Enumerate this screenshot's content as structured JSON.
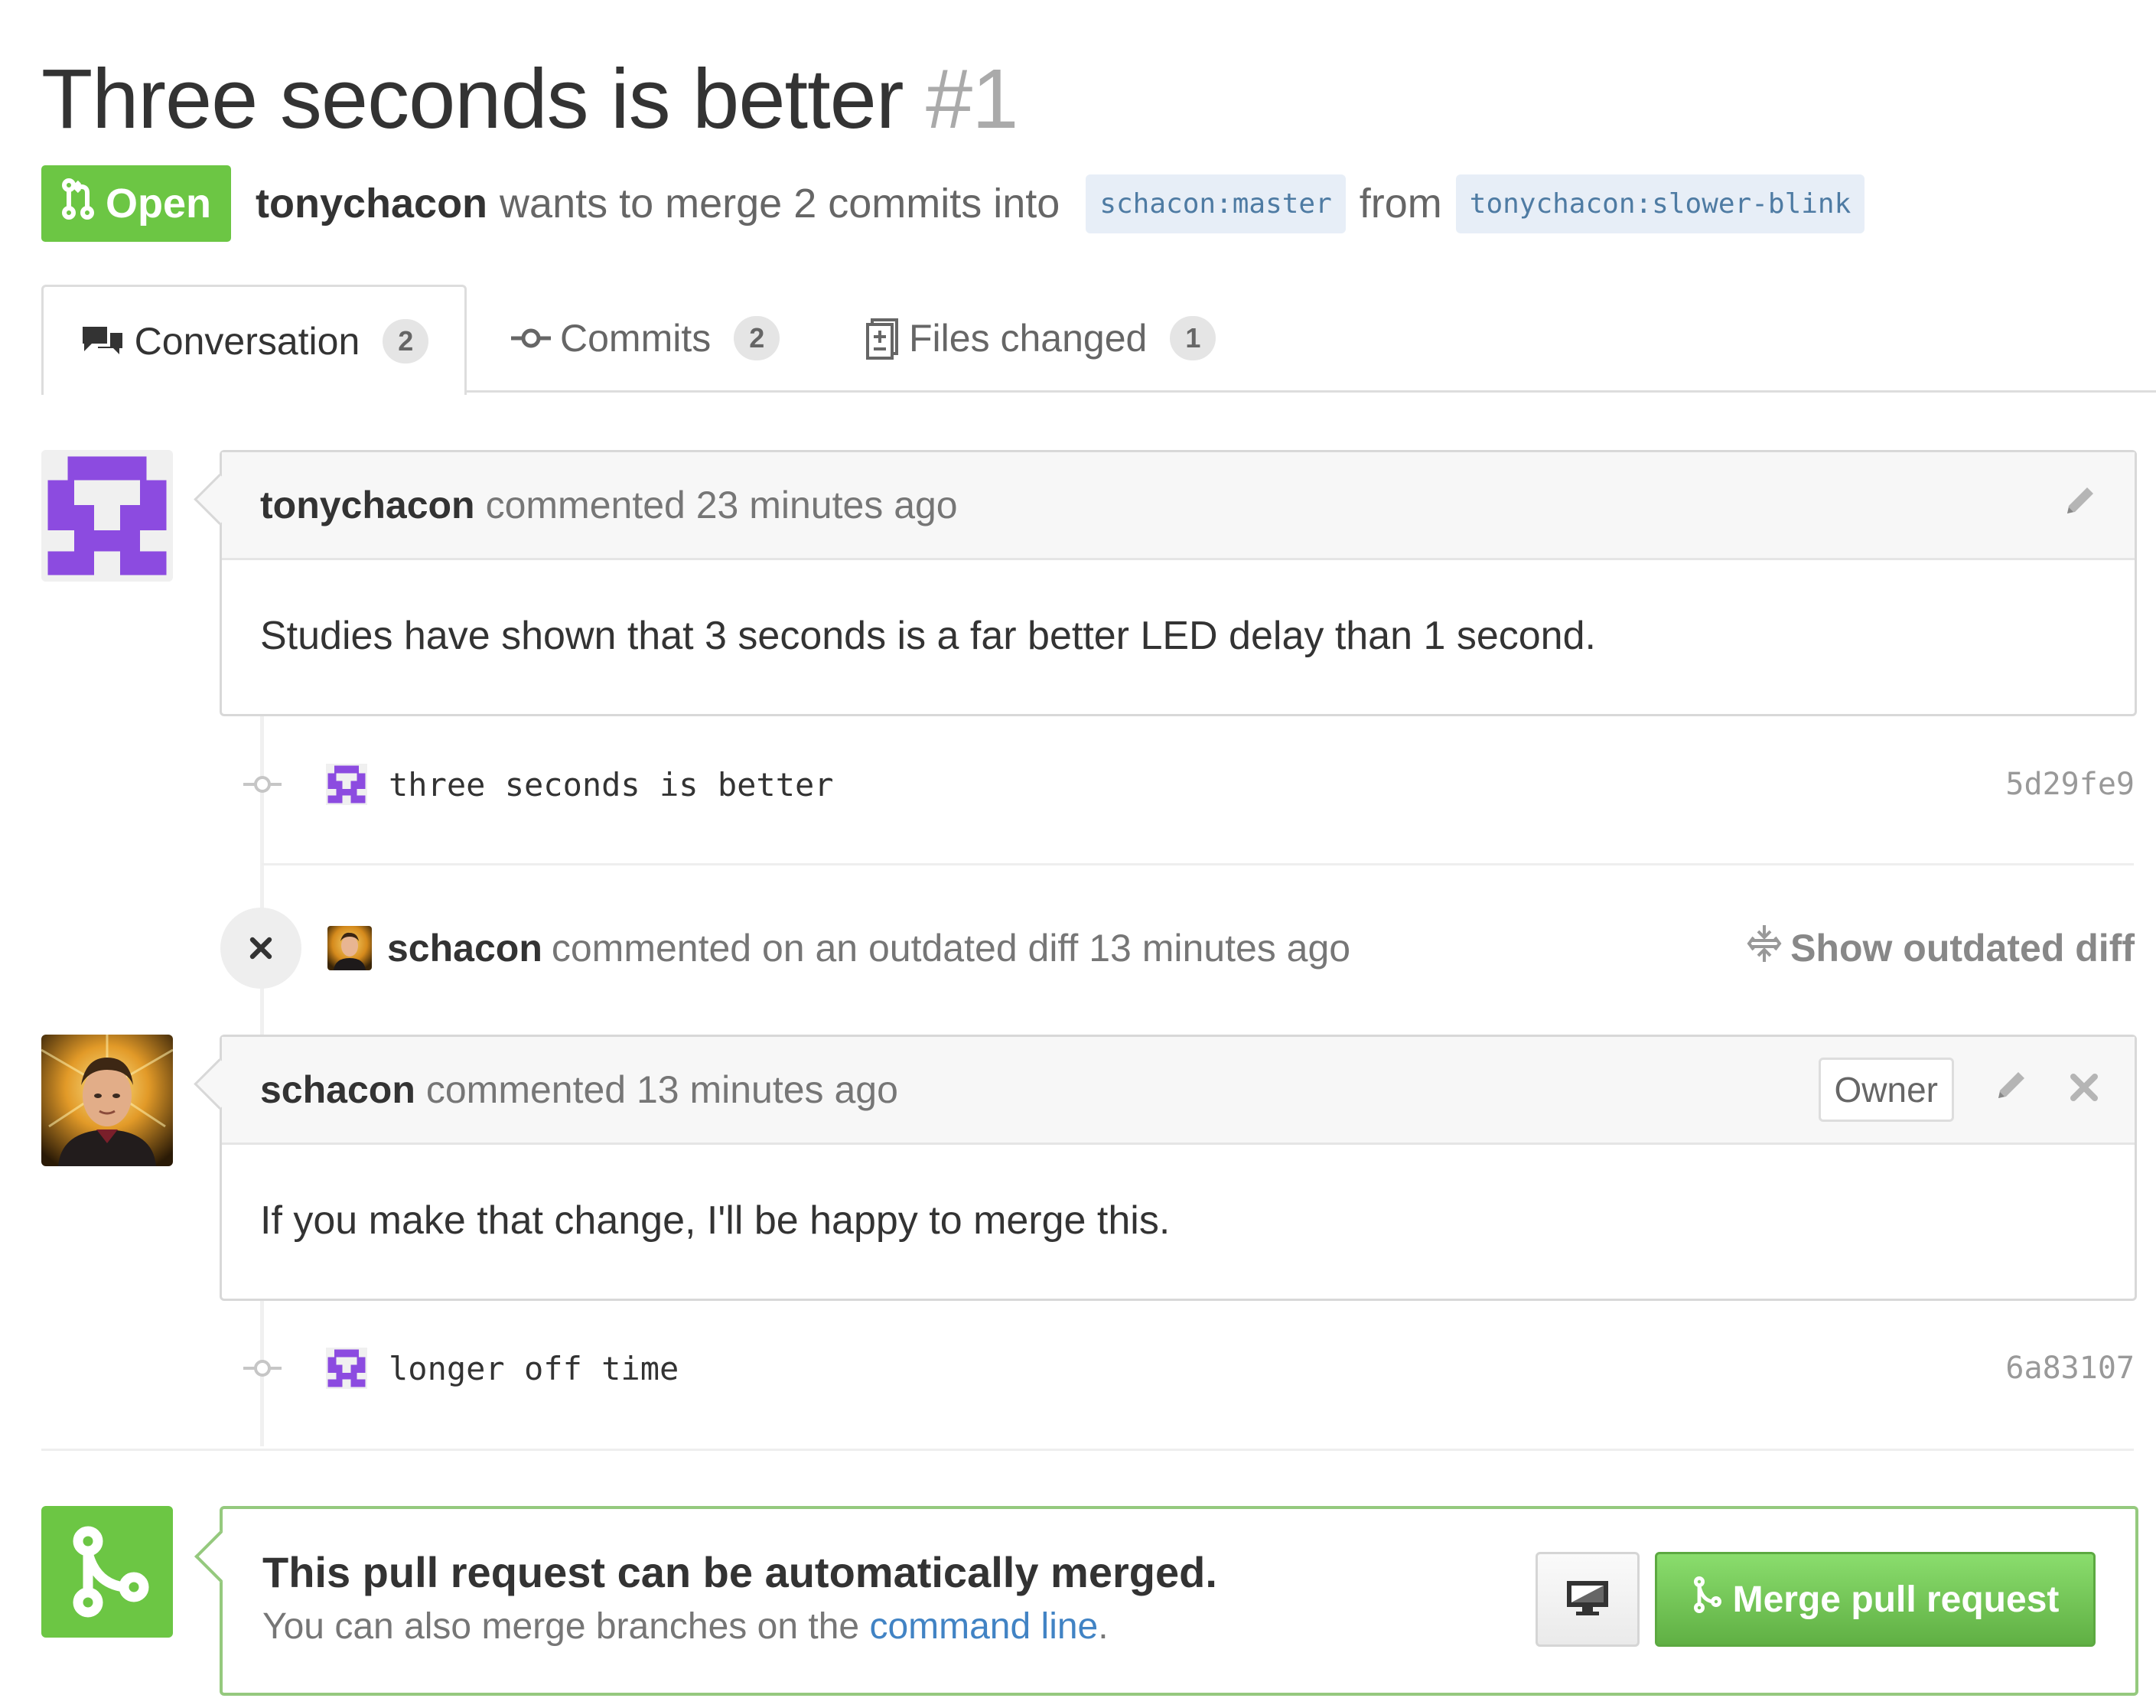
{
  "title": {
    "text": "Three seconds is better",
    "number": "#1"
  },
  "state": {
    "label": "Open",
    "color": "#6cc644",
    "icon": "pull-request-icon"
  },
  "meta": {
    "author": "tonychacon",
    "phrase": "wants to merge 2 commits into",
    "base_branch": "schacon:master",
    "from_word": "from",
    "head_branch": "tonychacon:slower-blink"
  },
  "tabs": [
    {
      "label": "Conversation",
      "count": "2",
      "icon": "comment-discussion-icon",
      "selected": true
    },
    {
      "label": "Commits",
      "count": "2",
      "icon": "commit-icon",
      "selected": false
    },
    {
      "label": "Files changed",
      "count": "1",
      "icon": "diff-icon",
      "selected": false
    }
  ],
  "timeline": {
    "comment1": {
      "author": "tonychacon",
      "meta": "commented 23 minutes ago",
      "body": "Studies have shown that 3 seconds is a far better LED delay than 1 second."
    },
    "commit1": {
      "message": "three seconds is better",
      "sha": "5d29fe9"
    },
    "outdated": {
      "author": "schacon",
      "meta": "commented on an outdated diff 13 minutes ago",
      "action": "Show outdated diff"
    },
    "comment2": {
      "author": "schacon",
      "meta": "commented 13 minutes ago",
      "badge": "Owner",
      "body": "If you make that change, I'll be happy to merge this."
    },
    "commit2": {
      "message": "longer off time",
      "sha": "6a83107"
    }
  },
  "merge": {
    "title": "This pull request can be automatically merged.",
    "sub_prefix": "You can also merge branches on the",
    "sub_link": "command line",
    "sub_suffix": ".",
    "button": "Merge pull request"
  },
  "colors": {
    "green": "#6cc644",
    "link": "#4183c4",
    "identicon": "#8c4be0",
    "branch_bg": "#e7eef7"
  }
}
